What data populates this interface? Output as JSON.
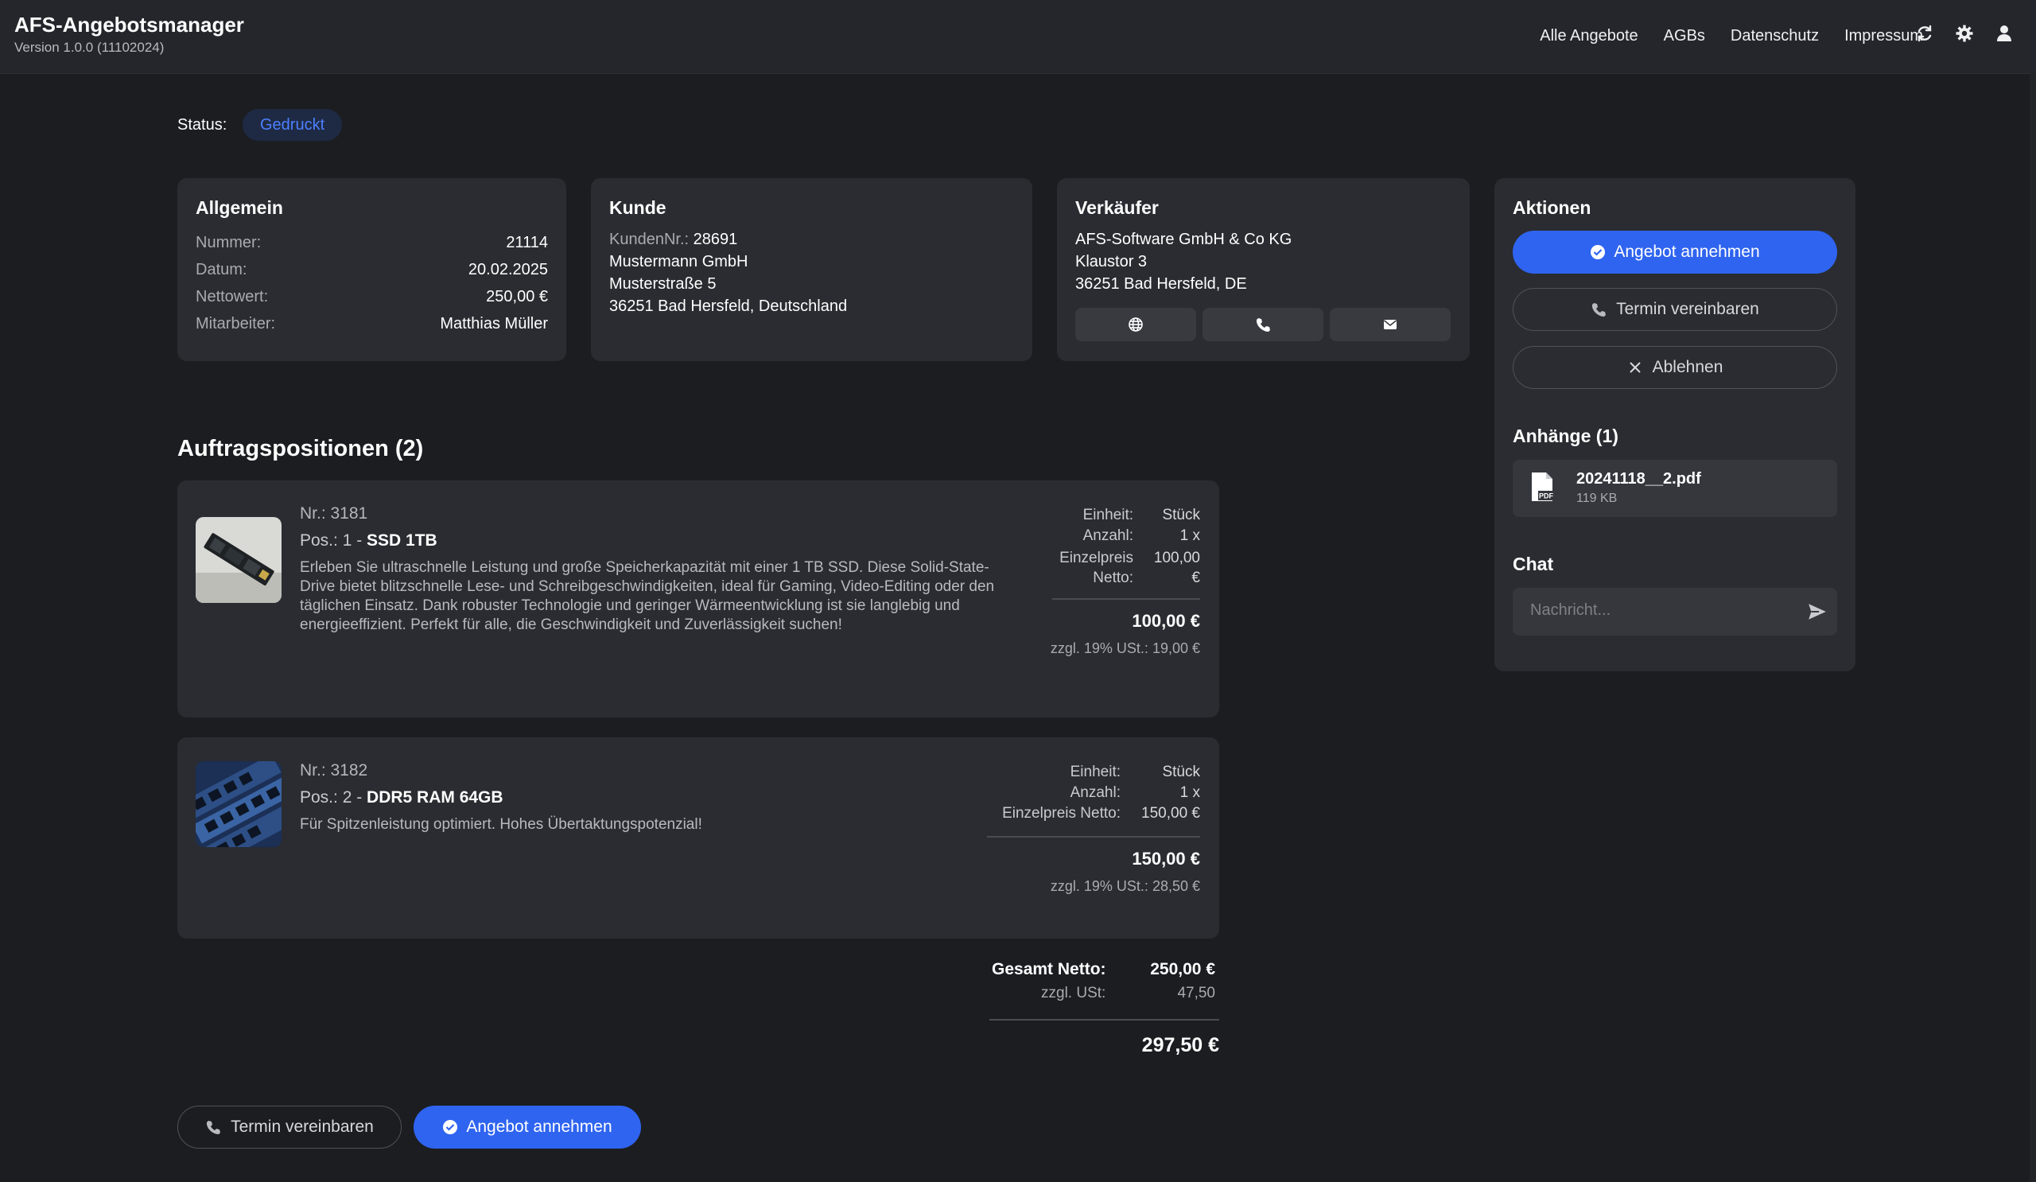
{
  "app": {
    "title": "AFS-Angebotsmanager",
    "version": "Version 1.0.0 (11102024)"
  },
  "nav": {
    "links": [
      "Alle Angebote",
      "AGBs",
      "Datenschutz",
      "Impressum"
    ],
    "icons": [
      "refresh-icon",
      "gear-icon",
      "user-icon"
    ]
  },
  "status": {
    "label": "Status:",
    "value": "Gedruckt"
  },
  "allgemein": {
    "title": "Allgemein",
    "rows": [
      {
        "label": "Nummer:",
        "value": "21114"
      },
      {
        "label": "Datum:",
        "value": "20.02.2025"
      },
      {
        "label": "Nettowert:",
        "value": "250,00 €"
      },
      {
        "label": "Mitarbeiter:",
        "value": "Matthias Müller"
      }
    ]
  },
  "kunde": {
    "title": "Kunde",
    "nr_label": "KundenNr.:",
    "nr": "28691",
    "name": "Mustermann GmbH",
    "street": "Musterstraße 5",
    "city": "36251 Bad Hersfeld, Deutschland"
  },
  "verkaeufer": {
    "title": "Verkäufer",
    "name": "AFS-Software GmbH & Co KG",
    "street": "Klaustor 3",
    "city": "36251 Bad Hersfeld, DE",
    "buttons": [
      "globe-icon",
      "phone-icon",
      "mail-icon"
    ]
  },
  "aktionen": {
    "title": "Aktionen",
    "accept": "Angebot annehmen",
    "appointment": "Termin vereinbaren",
    "reject": "Ablehnen"
  },
  "anhaenge": {
    "title": "Anhänge (1)",
    "file": {
      "name": "20241118__2.pdf",
      "size": "119 KB"
    }
  },
  "chat": {
    "title": "Chat",
    "placeholder": "Nachricht..."
  },
  "positions": {
    "title": "Auftragspositionen (2)",
    "items": [
      {
        "nr": "Nr.: 3181",
        "pos_prefix": "Pos.: 1 - ",
        "name": "SSD 1TB",
        "desc": "Erleben Sie ultraschnelle Leistung und große Speicherkapazität mit einer 1 TB SSD. Diese Solid-State-Drive bietet blitzschnelle Lese- und Schreibgeschwindigkeiten, ideal für Gaming, Video-Editing oder den täglichen Einsatz. Dank robuster Technologie und geringer Wärmeentwicklung ist sie langlebig und energieeffizient. Perfekt für alle, die Geschwindigkeit und Zuverlässigkeit suchen!",
        "einheit_label": "Einheit:",
        "einheit": "Stück",
        "anzahl_label": "Anzahl:",
        "anzahl": "1 x",
        "preis_label": "Einzelpreis Netto:",
        "preis": "100,00 €",
        "total": "100,00 €",
        "vat": "zzgl. 19% USt.: 19,00 €"
      },
      {
        "nr": "Nr.: 3182",
        "pos_prefix": "Pos.: 2 - ",
        "name": "DDR5 RAM 64GB",
        "desc": "Für Spitzenleistung optimiert. Hohes Übertaktungspotenzial!",
        "einheit_label": "Einheit:",
        "einheit": "Stück",
        "anzahl_label": "Anzahl:",
        "anzahl": "1 x",
        "preis_label": "Einzelpreis Netto:",
        "preis": "150,00 €",
        "total": "150,00 €",
        "vat": "zzgl. 19% USt.: 28,50 €"
      }
    ]
  },
  "summary": {
    "net_label": "Gesamt Netto:",
    "net": "250,00 €",
    "vat_label": "zzgl. USt:",
    "vat": "47,50",
    "total": "297,50 €"
  },
  "bottom": {
    "appointment": "Termin vereinbaren",
    "accept": "Angebot annehmen"
  }
}
